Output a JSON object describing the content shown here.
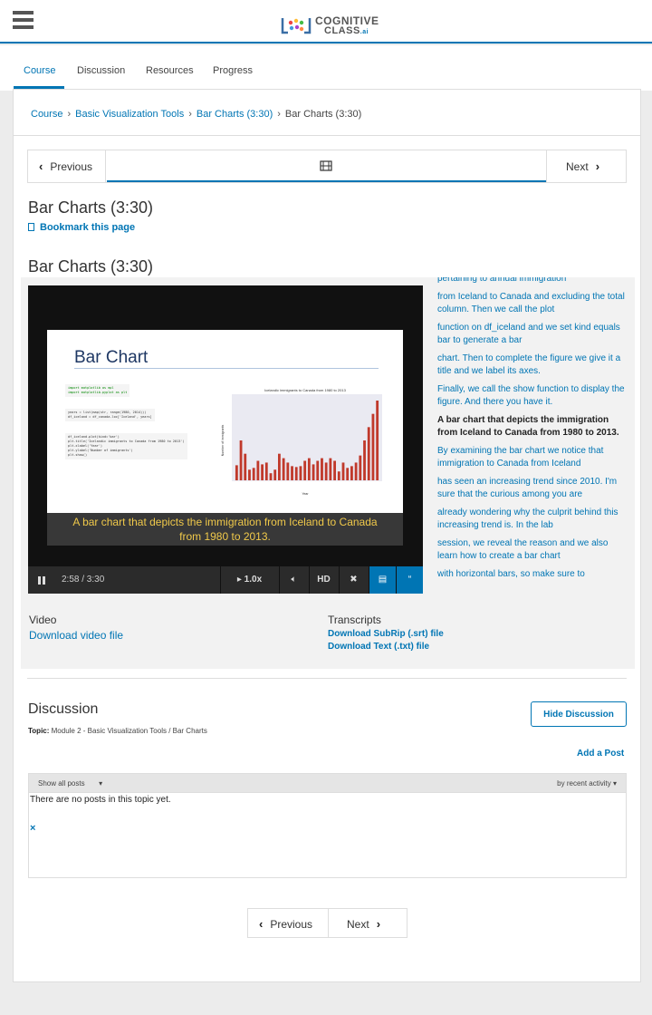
{
  "header": {
    "logo_line1": "COGNITIVE",
    "logo_line2": "CLASS",
    "logo_suffix": ".ai"
  },
  "course_nav": {
    "tabs": [
      {
        "label": "Course",
        "active": true
      },
      {
        "label": "Discussion",
        "active": false
      },
      {
        "label": "Resources",
        "active": false
      },
      {
        "label": "Progress",
        "active": false
      }
    ]
  },
  "breadcrumb": {
    "items": [
      "Course",
      "Basic Visualization Tools",
      "Bar Charts (3:30)"
    ],
    "current": "Bar Charts (3:30)",
    "separator": "›"
  },
  "sequence_nav": {
    "previous": "Previous",
    "next": "Next",
    "unit_icon": "film-icon"
  },
  "unit": {
    "title": "Bar Charts (3:30)",
    "bookmark": "Bookmark this page",
    "video_title": "Bar Charts (3:30)"
  },
  "video": {
    "slide_title": "Bar Chart",
    "caption_line1": "A bar chart that depicts the immigration from Iceland to Canada",
    "caption_line2": "from 1980 to 2013.",
    "time": "2:58 / 3:30",
    "progress_fraction": 0.848,
    "speed": "1.0x",
    "hd": "HD",
    "accent": "#c34b74",
    "code_lines": [
      [
        "import matplotlib as mpl",
        "import matplotlib.pyplot as plt"
      ],
      [
        "years = list(map(str, range(1980, 2014)))",
        "df_iceland = df_canada.loc['Iceland', years]"
      ],
      [
        "df_iceland.plot(kind='bar')",
        "plt.title('Icelandic immigrants to Canada from 1980 to 2013')",
        "plt.xlabel('Year')",
        "plt.ylabel('Number of immigrants')",
        "plt.show()"
      ]
    ],
    "minichart": {
      "title": "Icelandic immigrants to Canada from 1980 to 2013",
      "xlabel": "Year",
      "ylabel": "Number of immigrants",
      "values": [
        17,
        45,
        30,
        12,
        14,
        22,
        18,
        20,
        8,
        12,
        30,
        25,
        20,
        16,
        15,
        16,
        22,
        25,
        18,
        22,
        25,
        20,
        25,
        22,
        10,
        20,
        14,
        16,
        20,
        28,
        45,
        60,
        75,
        90
      ]
    }
  },
  "transcript": {
    "lines": [
      {
        "text": "pertaining to annual immigration",
        "current": false
      },
      {
        "text": "from Iceland to Canada and excluding the total column. Then we call the plot",
        "current": false
      },
      {
        "text": "function on df_iceland and we set kind equals bar to generate a bar",
        "current": false
      },
      {
        "text": "chart. Then to complete the figure we give it a title and we label its axes.",
        "current": false
      },
      {
        "text": "Finally, we call the show function to display the figure. And there you have it.",
        "current": false
      },
      {
        "text": "A bar chart that depicts the immigration from Iceland to Canada from 1980 to 2013.",
        "current": true
      },
      {
        "text": "By examining the bar chart we notice that immigration to Canada from Iceland",
        "current": false
      },
      {
        "text": "has seen an increasing trend since 2010. I'm sure that the curious among you are",
        "current": false
      },
      {
        "text": "already wondering why the culprit behind this increasing trend is. In the lab",
        "current": false
      },
      {
        "text": "session, we reveal the reason and we also learn how to create a bar chart",
        "current": false
      },
      {
        "text": "with horizontal bars, so make sure to",
        "current": false
      }
    ]
  },
  "downloads": {
    "video_heading": "Video",
    "video_link": "Download video file",
    "transcripts_heading": "Transcripts",
    "srt_link": "Download SubRip (.srt) file",
    "txt_link": "Download Text (.txt) file"
  },
  "discussion": {
    "title": "Discussion",
    "topic_label": "Topic:",
    "topic_value": "Module 2 - Basic Visualization Tools / Bar Charts",
    "hide_button": "Hide Discussion",
    "add_post": "Add a Post",
    "filter": "Show all posts",
    "sort": "by recent activity",
    "empty_message": "There are no posts in this topic yet.",
    "close_glyph": "×"
  },
  "bottom_nav": {
    "previous": "Previous",
    "next": "Next"
  }
}
